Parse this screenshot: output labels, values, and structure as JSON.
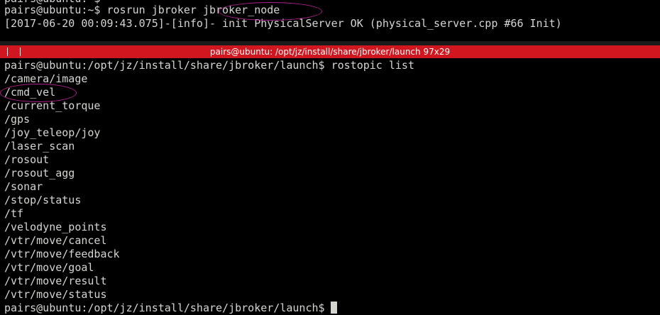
{
  "top_terminal": {
    "prev_prompt": "pairs@ubuntu:~$",
    "command_line": "pairs@ubuntu:~$ rosrun jbroker jbroker_node",
    "log_line": "[2017-06-20 00:09:43.075]-[info]- init PhysicalServer OK (physical_server.cpp #66 Init)"
  },
  "bottom_terminal": {
    "title": "pairs@ubuntu: /opt/jz/install/share/jbroker/launch 97x29",
    "command_line": "pairs@ubuntu:/opt/jz/install/share/jbroker/launch$ rostopic list",
    "topics": [
      "/camera/image",
      "/cmd_vel",
      "/current_torque",
      "/gps",
      "/joy_teleop/joy",
      "/laser_scan",
      "/rosout",
      "/rosout_agg",
      "/sonar",
      "/stop/status",
      "/tf",
      "/velodyne_points",
      "/vtr/move/cancel",
      "/vtr/move/feedback",
      "/vtr/move/goal",
      "/vtr/move/result",
      "/vtr/move/status"
    ],
    "final_prompt": "pairs@ubuntu:/opt/jz/install/share/jbroker/launch$"
  },
  "colors": {
    "titlebar": "#d0161e",
    "annotation": "#b0208f",
    "text": "#d3d7cf",
    "background": "#000000"
  }
}
